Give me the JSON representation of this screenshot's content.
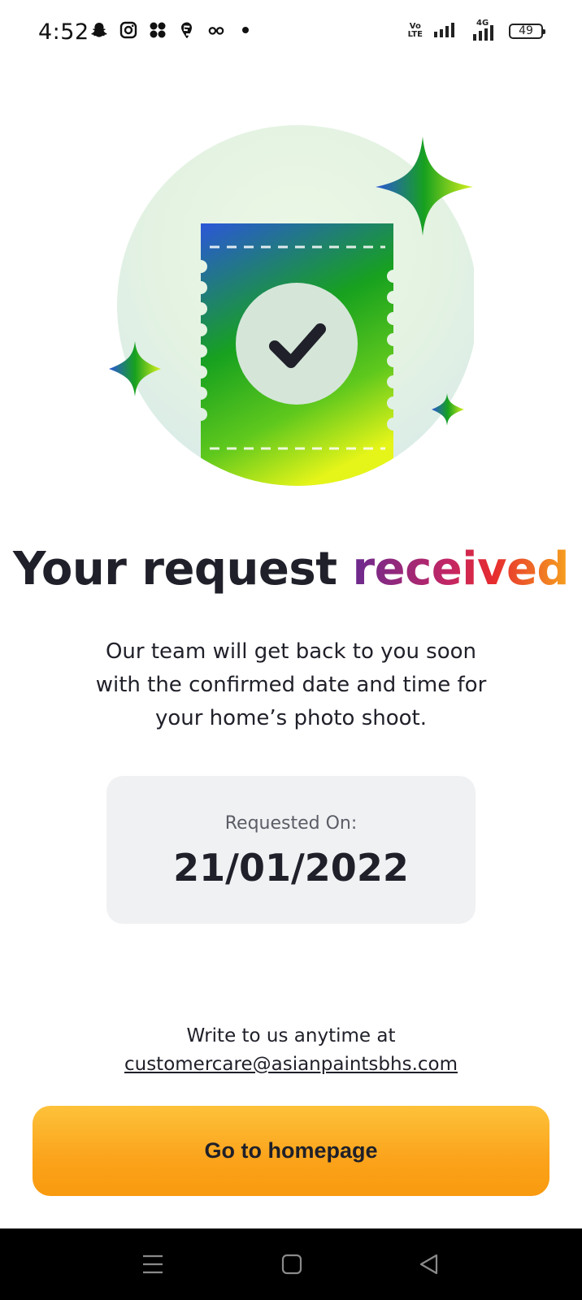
{
  "status_bar": {
    "time": "4:52",
    "left_icons": [
      "snapchat-icon",
      "instagram-icon",
      "app-icon",
      "swiggy-icon",
      "glasses-icon",
      "dot-icon"
    ],
    "network_label_top": "Vo",
    "network_label_bottom": "LTE",
    "network_gen": "4G",
    "battery_level": "49"
  },
  "illustration": {
    "icon": "ticket-check-icon",
    "accent_colors": [
      "#2b56d9",
      "#17a11f",
      "#e6f519"
    ]
  },
  "headline": {
    "prefix": "Your request ",
    "highlight": "received"
  },
  "message": "Our team will get back to you soon with the confirmed date and time for your home’s photo shoot.",
  "request": {
    "label": "Requested On:",
    "date": "21/01/2022"
  },
  "contact": {
    "line": "Write to us anytime at",
    "email": "customercare@asianpaintsbhs.com"
  },
  "primary_button": {
    "label": "Go to homepage",
    "color": "#fba31b"
  },
  "nav_bar": {
    "buttons": [
      "menu-icon",
      "home-square-icon",
      "back-triangle-icon"
    ]
  }
}
